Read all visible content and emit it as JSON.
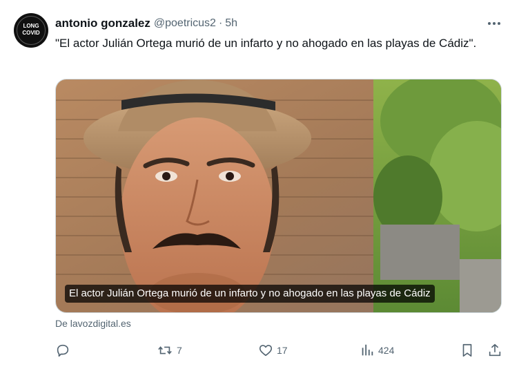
{
  "author": {
    "display_name": "antonio gonzalez",
    "handle": "@poetricus2",
    "time_separator": "·",
    "time": "5h",
    "avatar_label_top": "LONG",
    "avatar_label_bottom": "COVID"
  },
  "tweet": {
    "text": "\"El actor Julián Ortega murió de un infarto y no ahogado en las playas de Cádiz\"."
  },
  "media": {
    "caption": "El actor Julián Ortega murió de un infarto y no ahogado en las playas de Cádiz"
  },
  "source": {
    "label": "De lavozdigital.es"
  },
  "actions": {
    "reply": {
      "icon": "reply-icon",
      "count": ""
    },
    "retweet": {
      "icon": "retweet-icon",
      "count": "7"
    },
    "like": {
      "icon": "heart-icon",
      "count": "17"
    },
    "views": {
      "icon": "views-icon",
      "count": "424"
    },
    "bookmark": {
      "icon": "bookmark-icon"
    },
    "share": {
      "icon": "share-icon"
    }
  },
  "colors": {
    "text_primary": "#0f1419",
    "text_secondary": "#536471",
    "border": "#cfd9de"
  }
}
